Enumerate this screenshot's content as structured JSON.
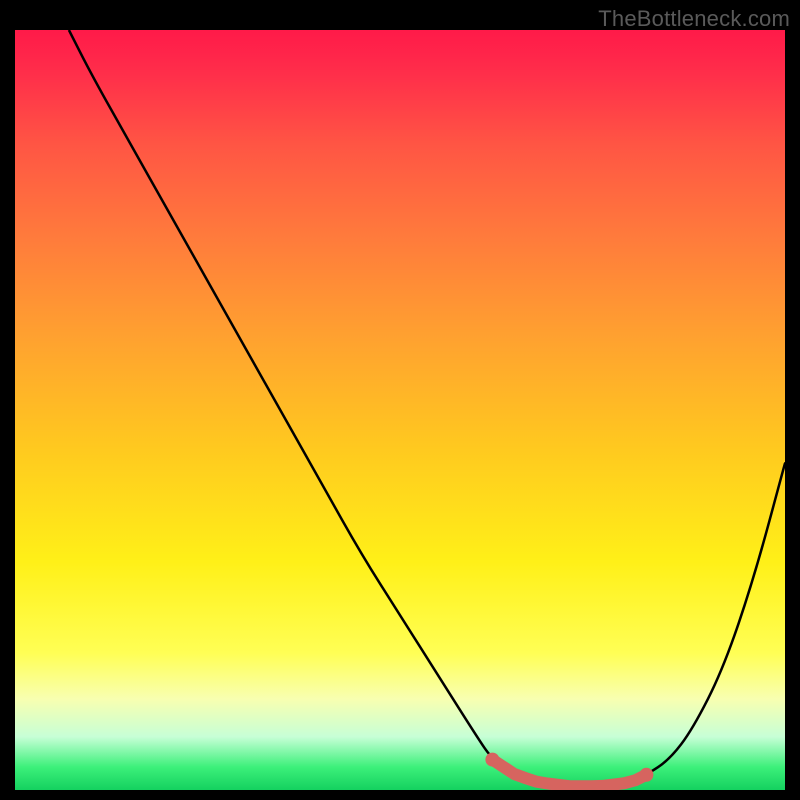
{
  "watermark": {
    "text": "TheBottleneck.com"
  },
  "chart_data": {
    "type": "line",
    "title": "",
    "xlabel": "",
    "ylabel": "",
    "xlim": [
      0,
      100
    ],
    "ylim": [
      0,
      100
    ],
    "legend_position": "none",
    "grid": false,
    "background_gradient": {
      "stops": [
        {
          "offset": 0.0,
          "color": "#ff1a49"
        },
        {
          "offset": 0.06,
          "color": "#ff2f4a"
        },
        {
          "offset": 0.15,
          "color": "#ff5544"
        },
        {
          "offset": 0.27,
          "color": "#ff7a3c"
        },
        {
          "offset": 0.4,
          "color": "#ffa030"
        },
        {
          "offset": 0.55,
          "color": "#ffc91f"
        },
        {
          "offset": 0.7,
          "color": "#fff018"
        },
        {
          "offset": 0.82,
          "color": "#ffff55"
        },
        {
          "offset": 0.88,
          "color": "#f8ffb0"
        },
        {
          "offset": 0.93,
          "color": "#c7ffd6"
        },
        {
          "offset": 0.97,
          "color": "#3cf07a"
        },
        {
          "offset": 1.0,
          "color": "#14d15f"
        }
      ]
    },
    "series": [
      {
        "name": "bottleneck-curve",
        "color": "#000000",
        "x": [
          7,
          10,
          15,
          20,
          25,
          30,
          35,
          40,
          45,
          50,
          55,
          60,
          62,
          65,
          68,
          72,
          76,
          80,
          82,
          85,
          88,
          92,
          96,
          100
        ],
        "y": [
          100,
          94,
          85,
          76,
          67,
          58,
          49,
          40,
          31,
          23,
          15,
          7,
          4,
          2,
          1,
          0.5,
          0.5,
          1,
          2,
          4,
          8,
          16,
          28,
          43
        ]
      }
    ],
    "optimal_band": {
      "color": "#d6645f",
      "x_range": [
        62,
        82
      ],
      "thickness": 12,
      "endpoint_markers": true
    }
  }
}
